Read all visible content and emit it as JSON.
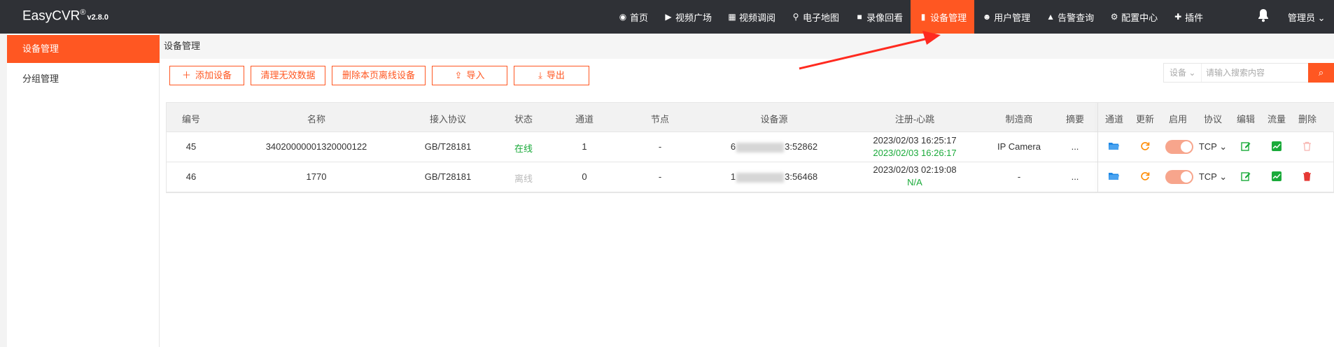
{
  "app": {
    "name": "EasyCVR",
    "registered": "®",
    "version": "v2.8.0"
  },
  "nav": [
    {
      "label": "首页",
      "icon": "dashboard-icon",
      "glyph": "◉"
    },
    {
      "label": "视频广场",
      "icon": "play-circle-icon",
      "glyph": "▶"
    },
    {
      "label": "视频调阅",
      "icon": "grid-icon",
      "glyph": "▦"
    },
    {
      "label": "电子地图",
      "icon": "map-pin-icon",
      "glyph": "⚲"
    },
    {
      "label": "录像回看",
      "icon": "video-camera-icon",
      "glyph": "■"
    },
    {
      "label": "设备管理",
      "icon": "device-icon",
      "glyph": "▮",
      "active": true
    },
    {
      "label": "用户管理",
      "icon": "user-icon",
      "glyph": "☻"
    },
    {
      "label": "告警查询",
      "icon": "alarm-icon",
      "glyph": "▲"
    },
    {
      "label": "配置中心",
      "icon": "gear-icon",
      "glyph": "⚙"
    },
    {
      "label": "插件",
      "icon": "puzzle-icon",
      "glyph": "✚"
    }
  ],
  "header_right": {
    "bell_icon": "bell-icon",
    "admin_label": "管理员",
    "chevron": "⌄"
  },
  "sidebar": {
    "items": [
      {
        "label": "设备管理",
        "active": true
      },
      {
        "label": "分组管理"
      }
    ]
  },
  "breadcrumb": "设备管理",
  "toolbar": {
    "add": {
      "label": "添加设备",
      "icon": "plus-icon",
      "glyph": "＋"
    },
    "clean": {
      "label": "清理无效数据"
    },
    "delete_offline": {
      "label": "删除本页离线设备"
    },
    "import": {
      "label": "导入",
      "icon": "upload-icon",
      "glyph": "⇪"
    },
    "export": {
      "label": "导出",
      "icon": "download-icon",
      "glyph": "⤓"
    }
  },
  "search": {
    "select_value": "设备",
    "select_arrow": "⌄",
    "placeholder": "请输入搜索内容",
    "button_icon": "search-icon",
    "button_glyph": "⌕"
  },
  "table": {
    "columns": [
      "编号",
      "名称",
      "接入协议",
      "状态",
      "通道",
      "节点",
      "设备源",
      "注册-心跳",
      "制造商",
      "摘要",
      "通道",
      "更新",
      "启用",
      "协议",
      "编辑",
      "流量",
      "删除"
    ],
    "rows": [
      {
        "id": "45",
        "name": "34020000001320000122",
        "protocol": "GB/T28181",
        "status": "在线",
        "status_color": "#1aaa3a",
        "channels": "1",
        "node": "-",
        "source_prefix": "6",
        "source_suffix": "3:52862",
        "register_time": "2023/02/03 16:25:17",
        "heartbeat_time": "2023/02/03 16:26:17",
        "vendor": "IP Camera",
        "summary": "...",
        "transport": "TCP",
        "transport_arrow": "⌄",
        "delete_enabled": false
      },
      {
        "id": "46",
        "name": "1770",
        "protocol": "GB/T28181",
        "status": "离线",
        "status_color": "#bbbbbb",
        "channels": "0",
        "node": "-",
        "source_prefix": "1",
        "source_suffix": "3:56468",
        "register_time": "2023/02/03 02:19:08",
        "heartbeat_time": "N/A",
        "vendor": "-",
        "summary": "...",
        "transport": "TCP",
        "transport_arrow": "⌄",
        "delete_enabled": true
      }
    ]
  },
  "row_action_icons": {
    "channel": "folder-icon",
    "update": "refresh-icon",
    "enable": "toggle",
    "edit": "edit-icon",
    "traffic": "chart-icon",
    "delete": "trash-icon"
  },
  "colors": {
    "accent": "#ff5722",
    "topbar": "#2f3136",
    "online": "#1aaa3a",
    "annotation_arrow": "#ff2a1f"
  }
}
